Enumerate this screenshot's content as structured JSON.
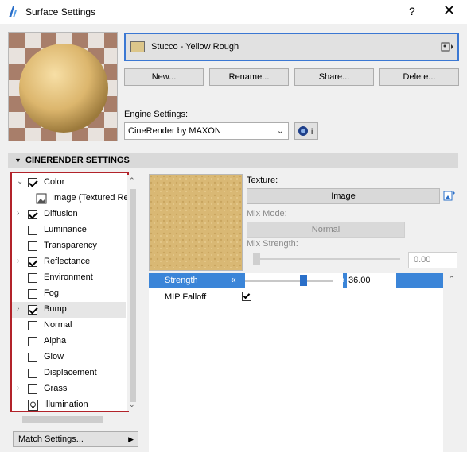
{
  "window": {
    "title": "Surface Settings",
    "help": "?",
    "close": "✕"
  },
  "material": {
    "name": "Stucco - Yellow Rough",
    "swatch_color": "#dcc68a"
  },
  "buttons": {
    "new": "New...",
    "rename": "Rename...",
    "share": "Share...",
    "delete": "Delete..."
  },
  "engine": {
    "label": "Engine Settings:",
    "selected": "CineRender by MAXON"
  },
  "section": {
    "title": "CINERENDER SETTINGS"
  },
  "channels": [
    {
      "label": "Color",
      "checked": true,
      "expandable": true,
      "expanded": true
    },
    {
      "label": "Image (Textured Re",
      "sub": true
    },
    {
      "label": "Diffusion",
      "checked": true,
      "expandable": true
    },
    {
      "label": "Luminance",
      "checked": false
    },
    {
      "label": "Transparency",
      "checked": false
    },
    {
      "label": "Reflectance",
      "checked": true,
      "expandable": true
    },
    {
      "label": "Environment",
      "checked": false
    },
    {
      "label": "Fog",
      "checked": false
    },
    {
      "label": "Bump",
      "checked": true,
      "expandable": true,
      "selected": true
    },
    {
      "label": "Normal",
      "checked": false
    },
    {
      "label": "Alpha",
      "checked": false
    },
    {
      "label": "Glow",
      "checked": false
    },
    {
      "label": "Displacement",
      "checked": false
    },
    {
      "label": "Grass",
      "checked": false,
      "expandable": true
    },
    {
      "label": "Illumination",
      "lamp": true
    }
  ],
  "match_settings": "Match Settings...",
  "texture": {
    "label": "Texture:",
    "value": "Image",
    "mix_mode_label": "Mix Mode:",
    "mix_mode_value": "Normal",
    "mix_strength_label": "Mix Strength:",
    "mix_strength_value": "0.00"
  },
  "params": {
    "strength_label": "Strength",
    "strength_value": "36.00",
    "mip_label": "MIP Falloff",
    "mip_checked": true
  }
}
